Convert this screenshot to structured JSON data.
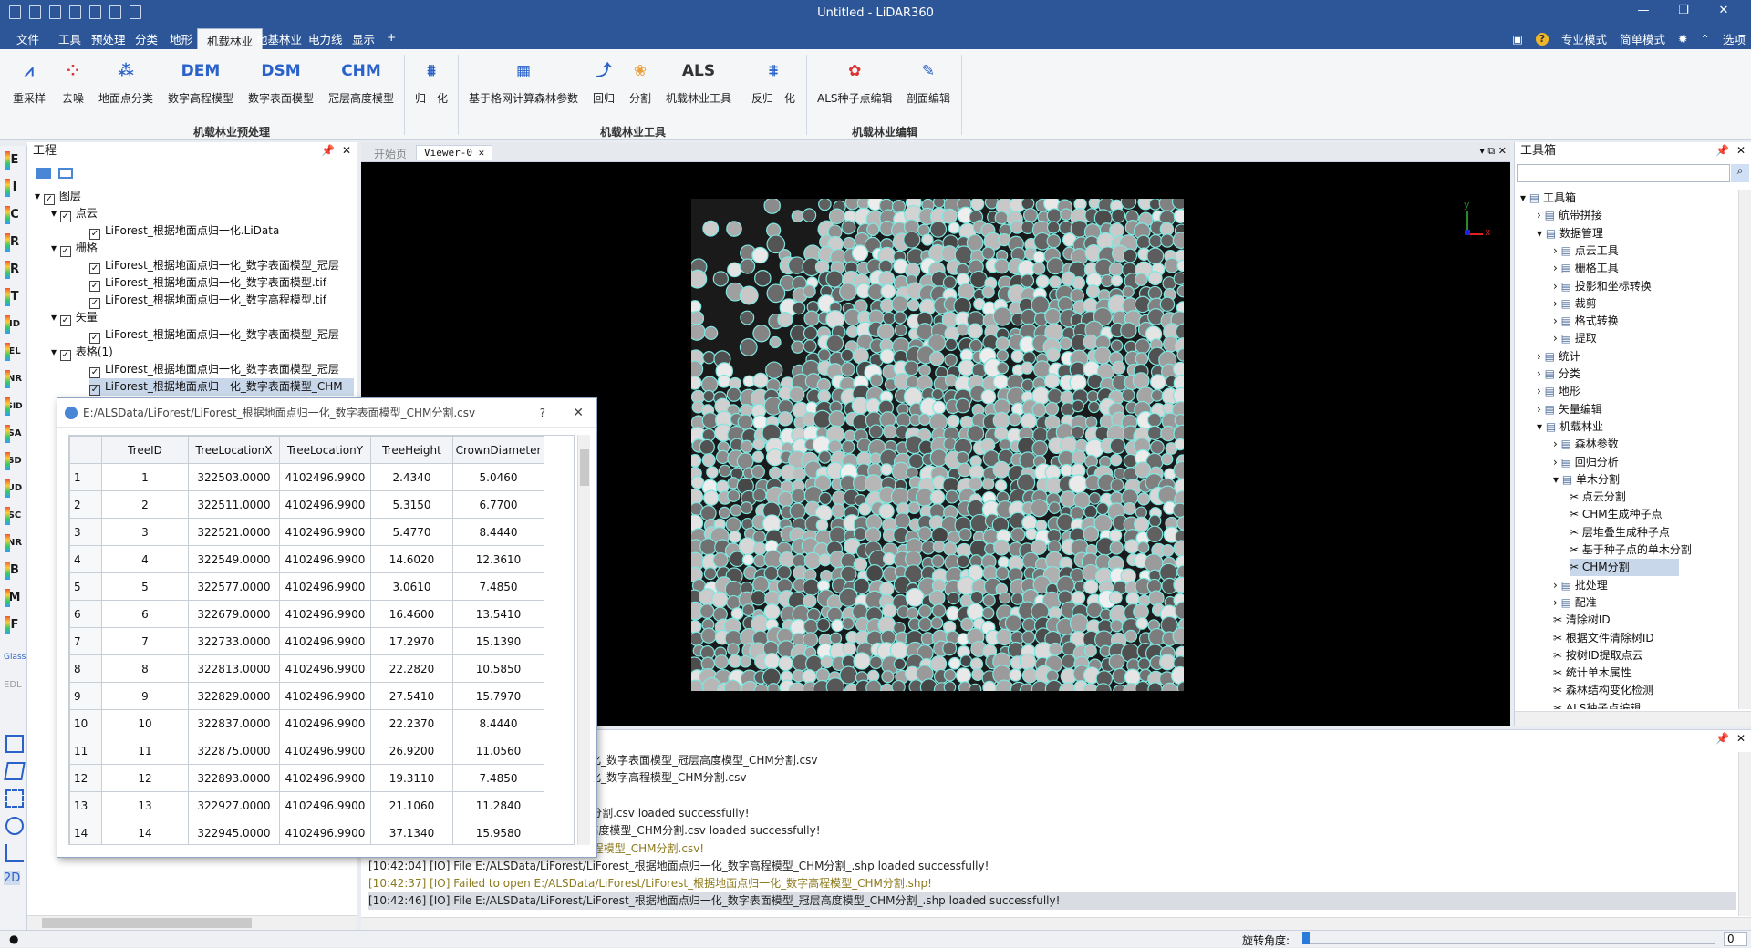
{
  "window": {
    "title": "Untitled - LiDAR360"
  },
  "menu": {
    "tabs": [
      "文件",
      "工具",
      "预处理",
      "分类",
      "地形",
      "机载林业",
      "地基林业",
      "电力线",
      "显示",
      "+"
    ],
    "active": "机载林业",
    "right": [
      "专业模式",
      "简单模式",
      "选项"
    ]
  },
  "ribbon": {
    "buttons": [
      {
        "label": "重采样",
        "icon": "resample-icon"
      },
      {
        "label": "去噪",
        "icon": "denoise-icon"
      },
      {
        "label": "地面点分类",
        "icon": "ground-classify-icon"
      },
      {
        "label": "数字高程模型",
        "icon_text": "DEM"
      },
      {
        "label": "数字表面模型",
        "icon_text": "DSM"
      },
      {
        "label": "冠层高度模型",
        "icon_text": "CHM"
      },
      {
        "label": "归一化",
        "icon": "normalize-icon"
      },
      {
        "label": "基于格网计算森林参数",
        "icon": "grid-forest-icon"
      },
      {
        "label": "回归",
        "icon": "regression-icon"
      },
      {
        "label": "分割",
        "icon": "segment-icon"
      },
      {
        "label": "机载林业工具",
        "icon_text": "ALS"
      },
      {
        "label": "反归一化",
        "icon": "denormalize-icon"
      },
      {
        "label": "ALS种子点编辑",
        "icon": "seed-edit-icon"
      },
      {
        "label": "剖面编辑",
        "icon": "profile-edit-icon"
      }
    ],
    "groups": [
      "机载林业预处理",
      "机载林业工具",
      "机载林业编辑"
    ]
  },
  "left_tools": [
    "E",
    "I",
    "C",
    "R",
    "R",
    "T",
    "ID",
    "EL",
    "NR",
    "SID",
    "SA",
    "SD",
    "UD",
    "SC",
    "NR",
    "B",
    "M",
    "F",
    "Glass",
    "EDL",
    "2D"
  ],
  "project": {
    "title": "工程",
    "tree": [
      {
        "label": "图层",
        "level": 0
      },
      {
        "label": "点云",
        "level": 1
      },
      {
        "label": "LiForest_根据地面点归一化.LiData",
        "level": 2
      },
      {
        "label": "栅格",
        "level": 1
      },
      {
        "label": "LiForest_根据地面点归一化_数字表面模型_冠层",
        "level": 2
      },
      {
        "label": "LiForest_根据地面点归一化_数字表面模型.tif",
        "level": 2
      },
      {
        "label": "LiForest_根据地面点归一化_数字高程模型.tif",
        "level": 2
      },
      {
        "label": "矢量",
        "level": 1
      },
      {
        "label": "LiForest_根据地面点归一化_数字表面模型_冠层",
        "level": 2
      },
      {
        "label": "表格(1)",
        "level": 1
      },
      {
        "label": "LiForest_根据地面点归一化_数字表面模型_冠层",
        "level": 2
      },
      {
        "label": "LiForest_根据地面点归一化_数字表面模型_CHM",
        "level": 2
      }
    ]
  },
  "viewer": {
    "tabs": [
      "开始页",
      "Viewer-0"
    ],
    "axis_x": "x",
    "axis_y": "y"
  },
  "toolbox": {
    "title": "工具箱",
    "tree": [
      {
        "label": "工具箱",
        "level": 0
      },
      {
        "label": "航带拼接",
        "level": 1
      },
      {
        "label": "数据管理",
        "level": 1
      },
      {
        "label": "点云工具",
        "level": 2
      },
      {
        "label": "栅格工具",
        "level": 2
      },
      {
        "label": "投影和坐标转换",
        "level": 2
      },
      {
        "label": "裁剪",
        "level": 2
      },
      {
        "label": "格式转换",
        "level": 2
      },
      {
        "label": "提取",
        "level": 2
      },
      {
        "label": "统计",
        "level": 1
      },
      {
        "label": "分类",
        "level": 1
      },
      {
        "label": "地形",
        "level": 1
      },
      {
        "label": "矢量编辑",
        "level": 1
      },
      {
        "label": "机载林业",
        "level": 1
      },
      {
        "label": "森林参数",
        "level": 2
      },
      {
        "label": "回归分析",
        "level": 2
      },
      {
        "label": "单木分割",
        "level": 2
      },
      {
        "label": "点云分割",
        "level": 3
      },
      {
        "label": "CHM生成种子点",
        "level": 3
      },
      {
        "label": "层堆叠生成种子点",
        "level": 3
      },
      {
        "label": "基于种子点的单木分割",
        "level": 3
      },
      {
        "label": "CHM分割",
        "level": 3
      },
      {
        "label": "批处理",
        "level": 2
      },
      {
        "label": "配准",
        "level": 2
      },
      {
        "label": "清除树ID",
        "level": 2
      },
      {
        "label": "根据文件清除树ID",
        "level": 2
      },
      {
        "label": "按树ID提取点云",
        "level": 2
      },
      {
        "label": "统计单木属性",
        "level": 2
      },
      {
        "label": "森林结构变化检测",
        "level": 2
      },
      {
        "label": "ALS种子点编辑",
        "level": 2
      }
    ]
  },
  "log": {
    "lines": [
      {
        "text": "ALSData/LiForest/LiForest_根据地面点归一化_数字表面模型_冠层高度模型_CHM分割.csv",
        "color": "#222"
      },
      {
        "text": "ALSData/LiForest/LiForest_根据地面点归一化_数字高程模型_CHM分割.csv",
        "color": "#222"
      },
      {
        "text": "",
        "color": "#222"
      },
      {
        "text": "orest_根据地面点归一化_数字表面模型_CHM分割.csv loaded successfully!",
        "color": "#222"
      },
      {
        "text": "orest_根据地面点归一化_数字表面模型_冠层高度模型_CHM分割.csv loaded successfully!",
        "color": "#222"
      },
      {
        "text": "/LiForest/LiForest_根据地面点归一化_数字高程模型_CHM分割.csv!",
        "color": "#8c7a1e"
      },
      {
        "text": "[10:42:04] [IO]   File E:/ALSData/LiForest/LiForest_根据地面点归一化_数字高程模型_CHM分割_.shp loaded successfully!",
        "color": "#222"
      },
      {
        "text": "[10:42:37] [IO]   Failed to open E:/ALSData/LiForest/LiForest_根据地面点归一化_数字高程模型_CHM分割.shp!",
        "color": "#8c7a1e"
      },
      {
        "text": "[10:42:46] [IO]   File E:/ALSData/LiForest/LiForest_根据地面点归一化_数字表面模型_冠层高度模型_CHM分割_.shp loaded successfully!",
        "color": "#222"
      }
    ]
  },
  "status": {
    "rotation_label": "旋转角度:",
    "rotation_value": "0"
  },
  "dialog": {
    "title": "E:/ALSData/LiForest/LiForest_根据地面点归一化_数字表面模型_CHM分割.csv",
    "help": "?",
    "close": "✕",
    "columns": [
      "TreeID",
      "TreeLocationX",
      "TreeLocationY",
      "TreeHeight",
      "CrownDiameter"
    ],
    "rows": [
      [
        "1",
        "1",
        "322503.0000",
        "4102496.9900",
        "2.4340",
        "5.0460"
      ],
      [
        "2",
        "2",
        "322511.0000",
        "4102496.9900",
        "5.3150",
        "6.7700"
      ],
      [
        "3",
        "3",
        "322521.0000",
        "4102496.9900",
        "5.4770",
        "8.4440"
      ],
      [
        "4",
        "4",
        "322549.0000",
        "4102496.9900",
        "14.6020",
        "12.3610"
      ],
      [
        "5",
        "5",
        "322577.0000",
        "4102496.9900",
        "3.0610",
        "7.4850"
      ],
      [
        "6",
        "6",
        "322679.0000",
        "4102496.9900",
        "16.4600",
        "13.5410"
      ],
      [
        "7",
        "7",
        "322733.0000",
        "4102496.9900",
        "17.2970",
        "15.1390"
      ],
      [
        "8",
        "8",
        "322813.0000",
        "4102496.9900",
        "22.2820",
        "10.5850"
      ],
      [
        "9",
        "9",
        "322829.0000",
        "4102496.9900",
        "27.5410",
        "15.7970"
      ],
      [
        "10",
        "10",
        "322837.0000",
        "4102496.9900",
        "22.2370",
        "8.4440"
      ],
      [
        "11",
        "11",
        "322875.0000",
        "4102496.9900",
        "26.9200",
        "11.0560"
      ],
      [
        "12",
        "12",
        "322893.0000",
        "4102496.9900",
        "19.3110",
        "7.4850"
      ],
      [
        "13",
        "13",
        "322927.0000",
        "4102496.9900",
        "21.1060",
        "11.2840"
      ],
      [
        "14",
        "14",
        "322945.0000",
        "4102496.9900",
        "37.1340",
        "15.9580"
      ]
    ]
  }
}
